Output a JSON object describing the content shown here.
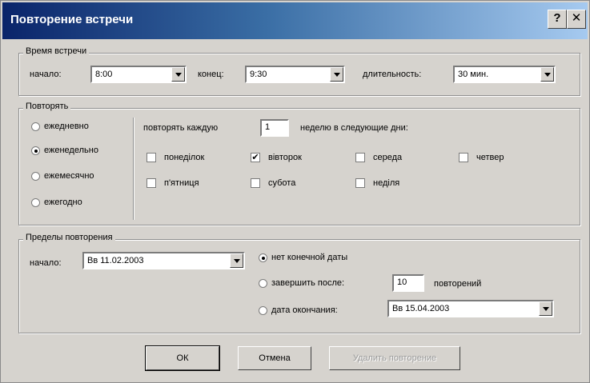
{
  "window": {
    "title": "Повторение встречи",
    "help_glyph": "?",
    "close_glyph": "✕"
  },
  "time_group": {
    "legend": "Время встречи",
    "start_label": "начало:",
    "start_value": "8:00",
    "end_label": "конец:",
    "end_value": "9:30",
    "duration_label": "длительность:",
    "duration_value": "30 мин."
  },
  "recur_group": {
    "legend": "Повторять",
    "options": [
      "ежедневно",
      "еженедельно",
      "ежемесячно",
      "ежегодно"
    ],
    "selected": "еженедельно",
    "every_label": "повторять каждую",
    "every_value": "1",
    "weeks_suffix": "неделю в следующие дни:",
    "days": [
      {
        "label": "понеділок",
        "checked": false
      },
      {
        "label": "вівторок",
        "checked": true
      },
      {
        "label": "середа",
        "checked": false
      },
      {
        "label": "четвер",
        "checked": false
      },
      {
        "label": "п'ятниця",
        "checked": false
      },
      {
        "label": "субота",
        "checked": false
      },
      {
        "label": "неділя",
        "checked": false
      }
    ]
  },
  "range_group": {
    "legend": "Пределы повторения",
    "start_label": "начало:",
    "start_value": "Вв 11.02.2003",
    "no_end_label": "нет конечной даты",
    "end_after_label": "завершить после:",
    "end_after_value": "10",
    "occurrences_label": "повторений",
    "end_by_label": "дата окончания:",
    "end_by_value": "Вв 15.04.2003",
    "selected": "нет конечной даты"
  },
  "buttons": {
    "ok": "ОК",
    "cancel": "Отмена",
    "remove": "Удалить повторение"
  }
}
